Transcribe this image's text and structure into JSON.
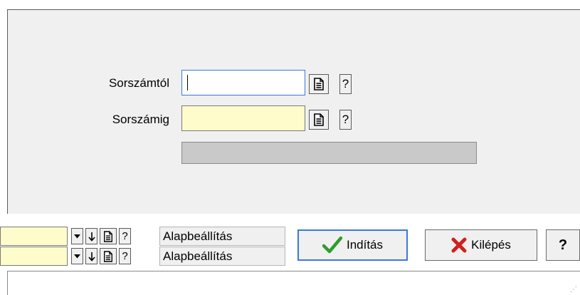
{
  "form": {
    "from_label": "Sorszámtól",
    "to_label": "Sorszámig",
    "from_value": "",
    "to_value": "",
    "help_label": "?"
  },
  "footer": {
    "rows": [
      {
        "preset_label": "Alapbeállítás",
        "help_label": "?"
      },
      {
        "preset_label": "Alapbeállítás",
        "help_label": "?"
      }
    ],
    "start_label": "Indítás",
    "exit_label": "Kilépés",
    "help_label": "?"
  },
  "colors": {
    "field_yellow": "#fffccc",
    "accent_blue": "#3c78d8",
    "check_green": "#2e9e2e",
    "cross_red": "#d31f1f"
  }
}
